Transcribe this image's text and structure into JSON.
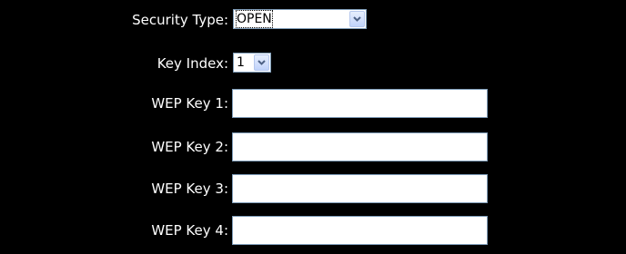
{
  "form": {
    "security_type": {
      "label": "Security Type:",
      "selected": "OPEN"
    },
    "key_index": {
      "label": "Key Index:",
      "selected": "1"
    },
    "wep_keys": [
      {
        "label": "WEP Key 1:",
        "value": ""
      },
      {
        "label": "WEP Key 2:",
        "value": ""
      },
      {
        "label": "WEP Key 3:",
        "value": ""
      },
      {
        "label": "WEP Key 4:",
        "value": ""
      }
    ]
  },
  "colors": {
    "background": "#000000",
    "label_text": "#ffffff",
    "field_border": "#7f9db9",
    "dropdown_button": "#c1d3fb",
    "dropdown_arrow": "#4d6185"
  }
}
